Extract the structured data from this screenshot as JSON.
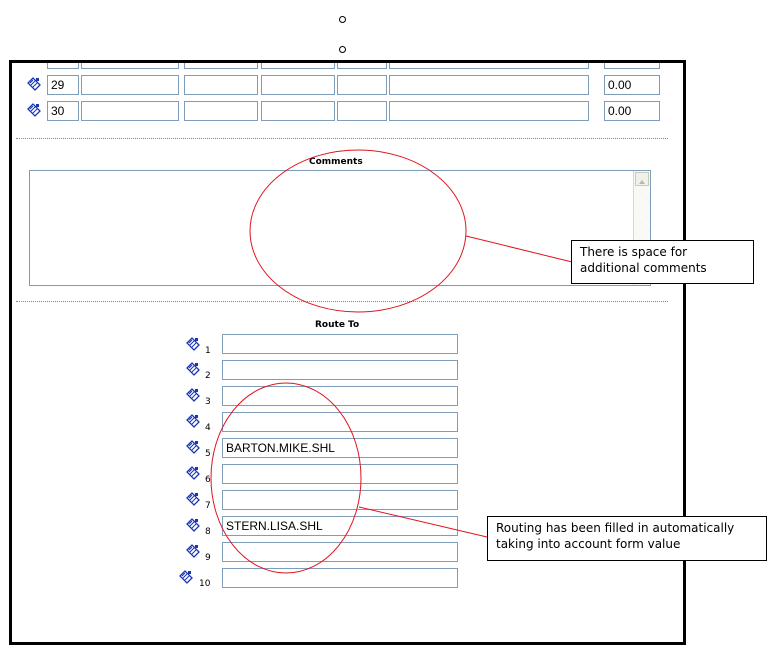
{
  "data_rows": [
    {
      "row": "29",
      "amount": "0.00"
    },
    {
      "row": "30",
      "amount": "0.00"
    }
  ],
  "comments": {
    "label": "Comments",
    "value": ""
  },
  "route_to": {
    "label": "Route To",
    "entries": [
      {
        "num": "1",
        "value": ""
      },
      {
        "num": "2",
        "value": ""
      },
      {
        "num": "3",
        "value": ""
      },
      {
        "num": "4",
        "value": ""
      },
      {
        "num": "5",
        "value": "BARTON.MIKE.SHL"
      },
      {
        "num": "6",
        "value": ""
      },
      {
        "num": "7",
        "value": ""
      },
      {
        "num": "8",
        "value": "STERN.LISA.SHL"
      },
      {
        "num": "9",
        "value": ""
      },
      {
        "num": "10",
        "value": ""
      }
    ]
  },
  "annotations": {
    "comments_note_line1": "There is space for",
    "comments_note_line2": "additional comments",
    "routing_note_line1": "Routing has been filled in automatically",
    "routing_note_line2": "taking into account form value"
  },
  "colors": {
    "annotation_red": "#e0141e",
    "field_border": "#7f9db9",
    "icon_blue": "#1a35b5"
  }
}
